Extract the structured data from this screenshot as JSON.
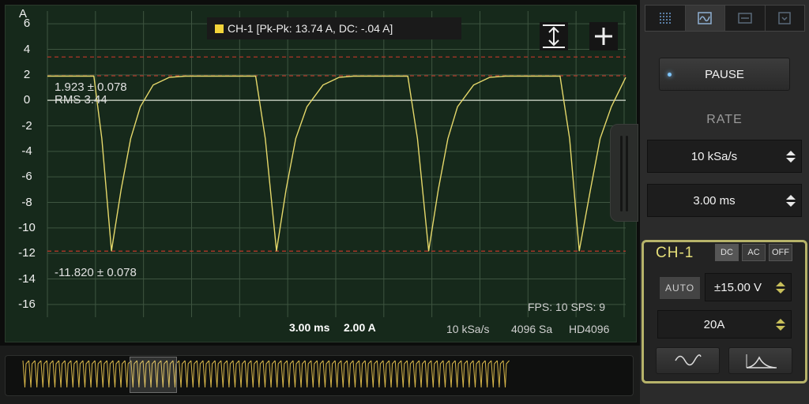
{
  "scope": {
    "unit": "A",
    "y_ticks": [
      "6",
      "4",
      "2",
      "0",
      "-2",
      "-4",
      "-6",
      "-8",
      "-10",
      "-12",
      "-14",
      "-16"
    ],
    "legend": "CH-1 [Pk-Pk: 13.74 A, DC: -.04 A]",
    "upper_cursor_label": "1.923 ± 0.078",
    "rms_label": "RMS 3.44",
    "lower_cursor_label": "-11.820 ± 0.078",
    "fps_sps": "FPS: 10  SPS: 9",
    "time_div": "3.00 ms",
    "amp_div": "2.00 A",
    "sample_rate": "10 kSa/s",
    "samples": "4096 Sa",
    "mode": "HD4096",
    "trace_color": "#e5d86a",
    "cursor_color": "#c0392b"
  },
  "panel": {
    "tabs": [
      "grid-icon",
      "scope-icon",
      "spectrum-icon",
      "download-icon"
    ],
    "pause_label": "PAUSE",
    "rate_heading": "RATE",
    "rate_value": "10 kSa/s",
    "timebase_value": "3.00 ms",
    "channel": {
      "title": "CH-1",
      "coupling": [
        "DC",
        "AC",
        "OFF"
      ],
      "active_coupling": "DC",
      "auto_label": "AUTO",
      "range_value": "±15.00 V",
      "probe_value": "20A"
    }
  },
  "chart_data": {
    "type": "line",
    "title": "",
    "xlabel": "",
    "ylabel": "A",
    "ylim": [
      -17,
      7
    ],
    "grid": true,
    "series": [
      {
        "name": "CH-1",
        "x_ms": [
          0,
          2.9,
          3.4,
          4.0,
          4.6,
          5.2,
          5.8,
          6.6,
          7.6,
          8.6,
          9.5,
          13.0,
          13.6,
          14.3,
          14.9,
          15.5,
          16.2,
          17.2,
          18.2,
          19.1,
          22.5,
          23.1,
          23.8,
          24.4,
          25.0,
          25.6,
          26.6,
          27.6,
          28.6,
          32.0,
          32.6,
          33.2,
          33.9,
          34.5,
          35.2,
          36.1
        ],
        "values": [
          1.9,
          1.9,
          -3.0,
          -11.8,
          -7.0,
          -3.0,
          -0.5,
          1.2,
          1.8,
          1.9,
          1.9,
          1.9,
          -3.0,
          -11.8,
          -7.0,
          -3.0,
          -0.5,
          1.2,
          1.8,
          1.9,
          1.9,
          -3.0,
          -11.8,
          -7.0,
          -3.0,
          -0.5,
          1.2,
          1.8,
          1.9,
          1.9,
          -3.0,
          -11.8,
          -7.0,
          -3.0,
          -0.5,
          1.8
        ]
      }
    ],
    "cursors": {
      "upper": 1.923,
      "rms": 3.44,
      "lower": -11.82
    }
  }
}
